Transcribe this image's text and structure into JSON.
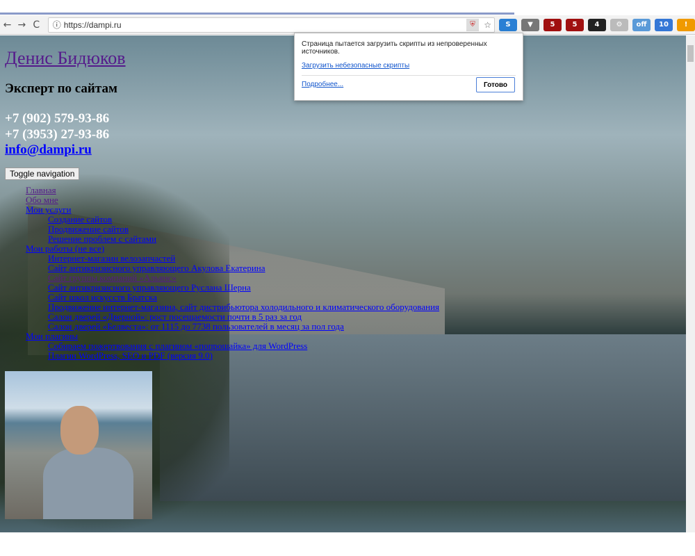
{
  "browser": {
    "url": "https://dampi.ru",
    "back": "←",
    "forward": "→",
    "reload": "C",
    "info": "ⓘ",
    "star": "☆",
    "extensions": [
      {
        "name": "s-ext",
        "label": "S",
        "color": "#2a7fd4"
      },
      {
        "name": "pocket",
        "label": "▼",
        "color": "#777"
      },
      {
        "name": "ublock-1",
        "label": "5",
        "color": "#a01010"
      },
      {
        "name": "ublock-2",
        "label": "5",
        "color": "#a01010"
      },
      {
        "name": "d-ext",
        "label": "4",
        "color": "#222"
      },
      {
        "name": "gear-ext",
        "label": "⚙",
        "color": "#bbb"
      },
      {
        "name": "a-ext",
        "label": "off",
        "color": "#5a9ad8"
      },
      {
        "name": "screen-ext",
        "label": "10",
        "color": "#3477d6"
      },
      {
        "name": "alert-ext",
        "label": "!",
        "color": "#f09a00"
      }
    ]
  },
  "popup": {
    "message": "Страница пытается загрузить скрипты из непроверенных источников.",
    "load_link": "Загрузить небезопасные скрипты",
    "more": "Подробнее...",
    "done": "Готово"
  },
  "site": {
    "title": "Денис Бидюков",
    "tagline": "Эксперт по сайтам",
    "phone1": "+7 (902) 579-93-86",
    "phone2": "+7 (3953) 27-93-86",
    "email": "info@dampi.ru",
    "toggle": "Toggle navigation",
    "menu": {
      "home": "Главная",
      "about": "Обо мне",
      "services": "Мои услуги",
      "services_items": [
        "Создание сайтов",
        "Продвижение сайтов",
        "Решение проблем с сайтами"
      ],
      "works": "Мои работы (не все)",
      "works_items": [
        "Интернет-магазин велозапчастей",
        "Сайт антикризисного управляющего Акулова Екатерина",
        "Сайт группы компаний «Альянс»",
        "Сайт антикризисного управляющего Руслана Шерна",
        "Сайт школ искусств Братска",
        "Продвижение интернет-магазина, сайт дистрибьютора холодильного и климатического оборудования",
        "Салон дверей «Дверной»: рост посещаемости почти в 5 раз за год",
        "Салон дверей «Белвеста»: от 1115 до 7738 пользователей в месяц за пол года"
      ],
      "plugins": "Мои плагины",
      "plugins_items": [
        "Собираем пожертвования с плагином «попрошайка» для WordPress",
        "Плагин WordPress, SEO и PDF (версия 9.0)"
      ]
    }
  }
}
